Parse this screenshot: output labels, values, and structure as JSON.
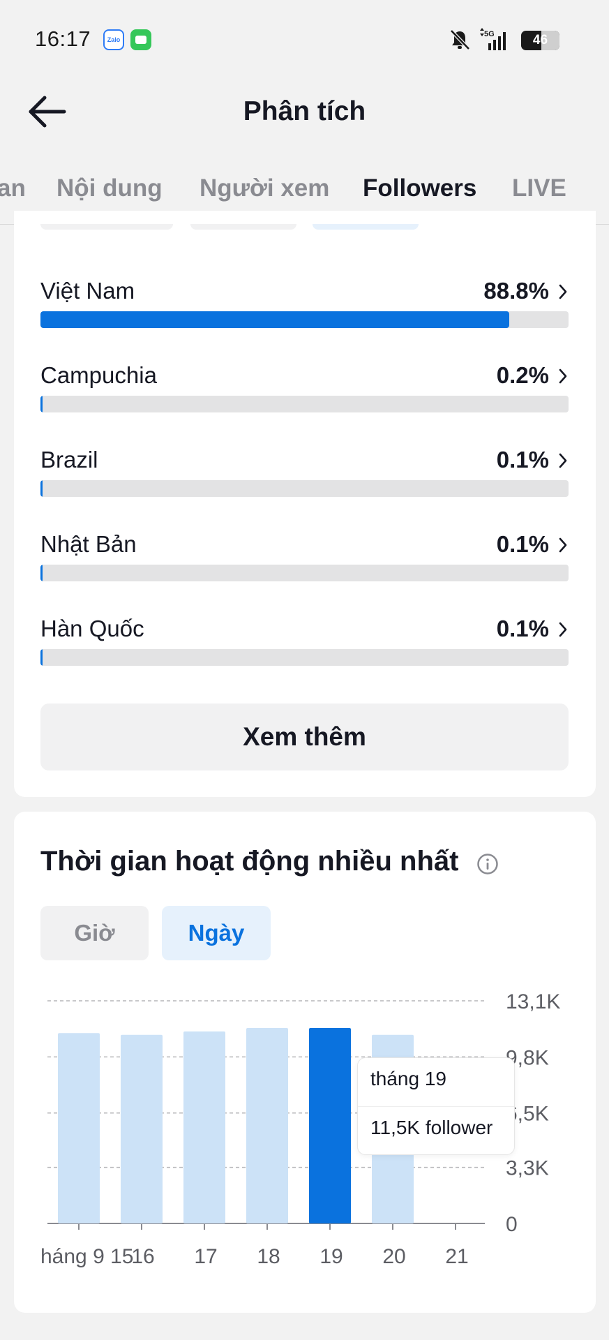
{
  "status_bar": {
    "time": "16:17",
    "zalo_label": "Zalo",
    "network": "5G",
    "battery": "46"
  },
  "header": {
    "title": "Phân tích"
  },
  "tabs": [
    {
      "label": "an",
      "active": false
    },
    {
      "label": "Nội dung",
      "active": false
    },
    {
      "label": "Người xem",
      "active": false
    },
    {
      "label": "Followers",
      "active": true
    },
    {
      "label": "LIVE",
      "active": false
    }
  ],
  "countries": [
    {
      "name": "Việt Nam",
      "percent_label": "88.8%",
      "share": 0.888
    },
    {
      "name": "Campuchia",
      "percent_label": "0.2%",
      "share": 0.002
    },
    {
      "name": "Brazil",
      "percent_label": "0.1%",
      "share": 0.001
    },
    {
      "name": "Nhật Bản",
      "percent_label": "0.1%",
      "share": 0.001
    },
    {
      "name": "Hàn Quốc",
      "percent_label": "0.1%",
      "share": 0.001
    }
  ],
  "see_more_label": "Xem thêm",
  "active_times": {
    "title": "Thời gian hoạt động nhiều nhất",
    "toggle_hour": "Giờ",
    "toggle_day": "Ngày",
    "selected_toggle": "Ngày",
    "tooltip": {
      "date": "tháng 19",
      "value": "11,5K follower"
    }
  },
  "colors": {
    "accent": "#0a72de",
    "bar_light": "#cce2f7",
    "track": "#e3e3e4"
  },
  "chart_data": {
    "type": "bar",
    "categories": [
      "tháng 9 15",
      "16",
      "17",
      "18",
      "19",
      "20",
      "21"
    ],
    "x_tick_labels": [
      "háng 9 15",
      "16",
      "17",
      "18",
      "19",
      "20",
      "21"
    ],
    "values": [
      11200,
      11100,
      11300,
      11500,
      11500,
      11100,
      0
    ],
    "highlighted_index": 4,
    "y_ticks": [
      0,
      3300,
      6500,
      9800,
      13100
    ],
    "y_tick_labels": [
      "0",
      "3,3K",
      "6,5K",
      "9,8K",
      "13,1K"
    ],
    "ylim": [
      0,
      13100
    ],
    "grid": true,
    "title": "",
    "xlabel": "",
    "ylabel": ""
  }
}
